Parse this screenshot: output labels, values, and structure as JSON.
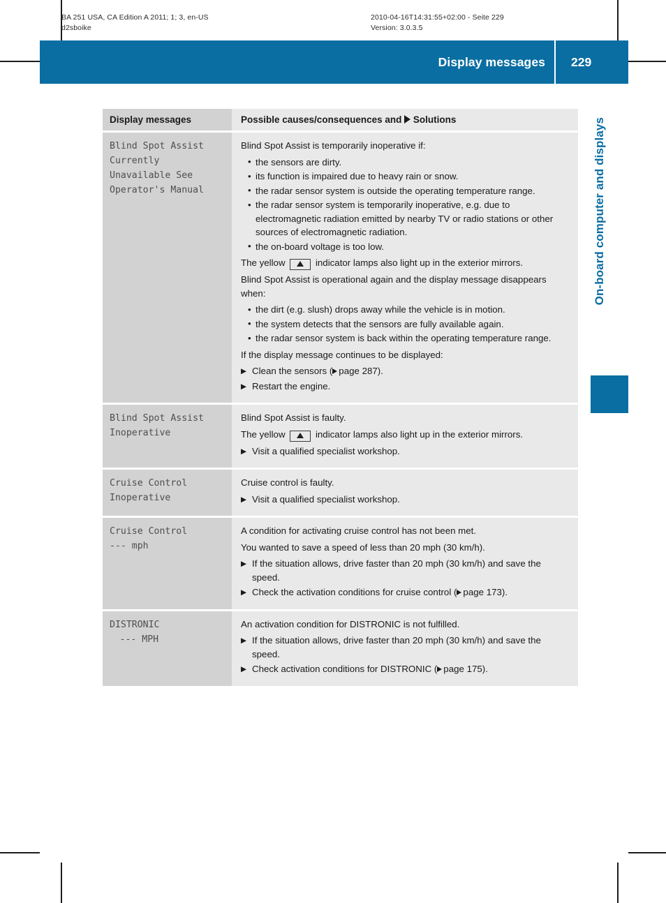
{
  "colors": {
    "brand": "#0a6ea3",
    "left_cell": "#d2d2d2",
    "right_cell": "#e9e9e9"
  },
  "print_meta": {
    "left": "BA 251 USA, CA Edition A 2011; 1; 3, en-US\nd2sboike",
    "right": "2010-04-16T14:31:55+02:00 - Seite 229\nVersion: 3.0.3.5"
  },
  "header": {
    "title": "Display messages",
    "page_number": "229"
  },
  "side_label": "On-board computer and displays",
  "table": {
    "head": {
      "left": "Display messages",
      "right_pre": "Possible causes/consequences and ",
      "right_post": " Solutions"
    },
    "rows": [
      {
        "message": "Blind Spot Assist\nCurrently\nUnavailable See\nOperator's Manual",
        "message_indent": "",
        "blocks": [
          {
            "kind": "para",
            "text": "Blind Spot Assist is temporarily inoperative if:"
          },
          {
            "kind": "bullets",
            "items": [
              "the sensors are dirty.",
              "its function is impaired due to heavy rain or snow.",
              "the radar sensor system is outside the operating temperature range.",
              "the radar sensor system is temporarily inoperative, e.g. due to electromagnetic radiation emitted by nearby TV or radio stations or other sources of electromagnetic radiation.",
              "the on-board voltage is too low."
            ]
          },
          {
            "kind": "lamp",
            "pre": "The yellow ",
            "post": " indicator lamps also light up in the exterior mirrors."
          },
          {
            "kind": "para",
            "text": "Blind Spot Assist is operational again and the display message disappears when:"
          },
          {
            "kind": "bullets",
            "items": [
              "the dirt (e.g. slush) drops away while the vehicle is in motion.",
              "the system detects that the sensors are fully available again.",
              "the radar sensor system is back within the operating temperature range."
            ]
          },
          {
            "kind": "para",
            "text": "If the display message continues to be displayed:"
          },
          {
            "kind": "steps",
            "items": [
              {
                "text": "Clean the sensors (",
                "xref": "page 287",
                "tail": ")."
              },
              {
                "text": "Restart the engine.",
                "xref": "",
                "tail": ""
              }
            ]
          }
        ]
      },
      {
        "message": "Blind Spot Assist\nInoperative",
        "message_indent": "",
        "blocks": [
          {
            "kind": "para",
            "text": "Blind Spot Assist is faulty."
          },
          {
            "kind": "lamp",
            "pre": "The yellow ",
            "post": " indicator lamps also light up in the exterior mirrors."
          },
          {
            "kind": "steps",
            "items": [
              {
                "text": "Visit a qualified specialist workshop.",
                "xref": "",
                "tail": ""
              }
            ]
          }
        ]
      },
      {
        "message": "Cruise Control\nInoperative",
        "message_indent": "",
        "blocks": [
          {
            "kind": "para",
            "text": "Cruise control is faulty."
          },
          {
            "kind": "steps",
            "items": [
              {
                "text": "Visit a qualified specialist workshop.",
                "xref": "",
                "tail": ""
              }
            ]
          }
        ]
      },
      {
        "message": "Cruise Control\n--- mph",
        "message_indent": "",
        "blocks": [
          {
            "kind": "para",
            "text": "A condition for activating cruise control has not been met."
          },
          {
            "kind": "para",
            "text": "You wanted to save a speed of less than 20 mph (30 km/h)."
          },
          {
            "kind": "steps",
            "items": [
              {
                "text": "If the situation allows, drive faster than 20 mph (30 km/h) and save the speed.",
                "xref": "",
                "tail": ""
              },
              {
                "text": "Check the activation conditions for cruise control (",
                "xref": "page 173",
                "tail": ")."
              }
            ]
          }
        ]
      },
      {
        "message": "DISTRONIC",
        "message_indent": "--- MPH",
        "blocks": [
          {
            "kind": "para",
            "text": "An activation condition for DISTRONIC is not fulfilled."
          },
          {
            "kind": "steps",
            "items": [
              {
                "text": "If the situation allows, drive faster than 20 mph (30 km/h) and save the speed.",
                "xref": "",
                "tail": ""
              },
              {
                "text": "Check activation conditions for DISTRONIC (",
                "xref": "page 175",
                "tail": ")."
              }
            ]
          }
        ]
      }
    ]
  }
}
